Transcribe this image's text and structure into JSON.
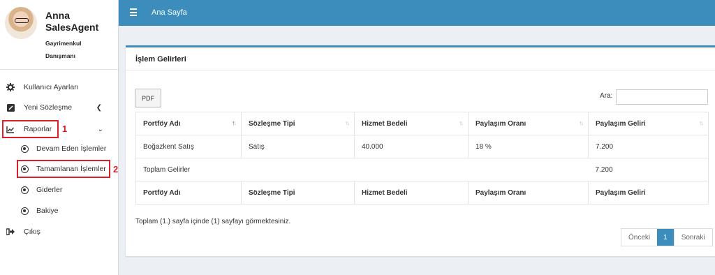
{
  "profile": {
    "first_name": "Anna",
    "last_name": "SalesAgent",
    "role_line1": "Gayrimenkul",
    "role_line2": "Danışmanı"
  },
  "sidebar": {
    "items": [
      {
        "label": "Kullanıcı Ayarları",
        "icon": "gear-icon"
      },
      {
        "label": "Yeni Sözleşme",
        "icon": "edit-icon"
      },
      {
        "label": "Raporlar",
        "icon": "line-chart-icon"
      },
      {
        "label": "Devam Eden İşlemler",
        "icon": "radio-dot-icon"
      },
      {
        "label": "Tamamlanan İşlemler",
        "icon": "radio-dot-icon"
      },
      {
        "label": "Giderler",
        "icon": "radio-dot-icon"
      },
      {
        "label": "Bakiye",
        "icon": "radio-dot-icon"
      },
      {
        "label": "Çıkış",
        "icon": "sign-out-icon"
      }
    ]
  },
  "annotations": {
    "mark1": "1",
    "mark2": "2",
    "color": "#dd1d28"
  },
  "topbar": {
    "title": "Ana Sayfa",
    "color": "#3c8dbc"
  },
  "box": {
    "title": "İşlem Gelirleri",
    "pdf_label": "PDF",
    "search_label": "Ara:",
    "search_value": "",
    "columns": [
      "Portföy Adı",
      "Sözleşme Tipi",
      "Hizmet Bedeli",
      "Paylaşım Oranı",
      "Paylaşım Geliri"
    ],
    "rows": [
      {
        "portfoy": "Boğazkent Satış",
        "tip": "Satış",
        "bedel": "40.000",
        "oran": "18 %",
        "gelir": "7.200"
      }
    ],
    "total": {
      "label": "Toplam Gelirler",
      "value": "7.200"
    },
    "info": "Toplam (1.) sayfa içinde (1) sayfayı görmektesiniz.",
    "pager": {
      "prev": "Önceki",
      "current": "1",
      "next": "Sonraki"
    }
  }
}
